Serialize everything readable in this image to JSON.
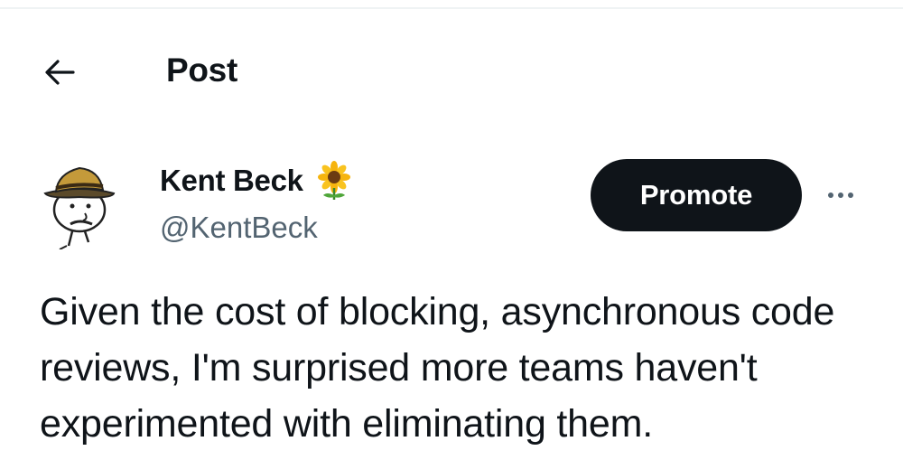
{
  "header": {
    "back_icon": "arrow-left-icon",
    "title": "Post"
  },
  "author": {
    "avatar_icon": "cartoon-avatar-with-hat",
    "name": "Kent Beck",
    "name_emoji_icon": "sunflower-emoji",
    "handle": "@KentBeck"
  },
  "actions": {
    "promote_label": "Promote",
    "more_icon": "more-horizontal-icon"
  },
  "tweet": {
    "text": "Given the cost of blocking, asynchronous code reviews, I'm surprised more teams haven't experimented with eliminating them."
  },
  "colors": {
    "text_primary": "#0f1419",
    "text_secondary": "#536471",
    "button_bg": "#0f1419",
    "button_text": "#ffffff"
  }
}
